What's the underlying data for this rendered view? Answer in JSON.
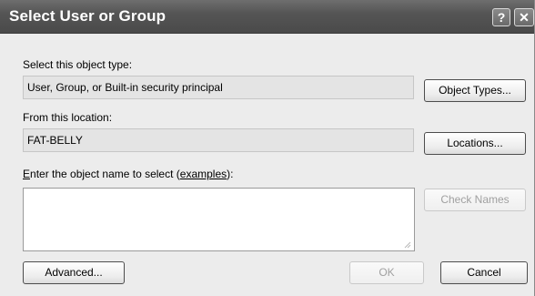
{
  "window": {
    "title": "Select User or Group",
    "help_glyph": "?",
    "close_glyph": "✕"
  },
  "object_type": {
    "label_prefix": "Select this object type:",
    "value": "User, Group, or Built-in security principal",
    "button": "Object Types..."
  },
  "location": {
    "label": "From this location:",
    "value": "FAT-BELLY",
    "button": "Locations..."
  },
  "object_name": {
    "label_lead": "E",
    "label_mid": "nter the object name to select (",
    "link": "examples",
    "label_tail": "):",
    "value": "",
    "check_names_button": "Check Names"
  },
  "footer": {
    "advanced_button": "Advanced...",
    "ok_button": "OK",
    "cancel_button": "Cancel"
  }
}
